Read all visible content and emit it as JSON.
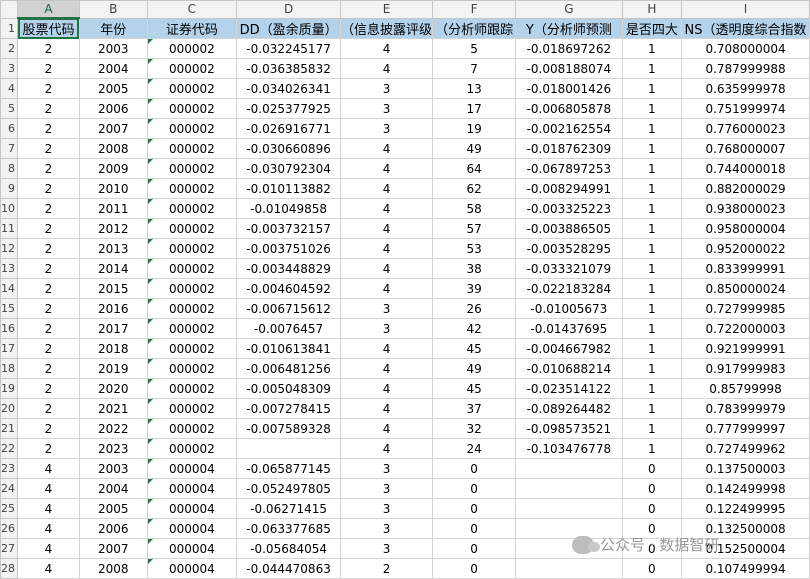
{
  "columns": [
    "A",
    "B",
    "C",
    "D",
    "E",
    "F",
    "G",
    "H",
    "I"
  ],
  "fields": [
    "股票代码",
    "年份",
    "证券代码",
    "DD（盈余质量）",
    "（信息披露评级",
    "（分析师跟踪",
    "Y（分析师预测",
    "是否四大",
    "NS（透明度综合指数"
  ],
  "row_numbers": [
    "1",
    "2",
    "3",
    "4",
    "5",
    "6",
    "7",
    "8",
    "9",
    "10",
    "11",
    "12",
    "13",
    "14",
    "15",
    "16",
    "17",
    "18",
    "19",
    "20",
    "21",
    "22",
    "23",
    "24",
    "25",
    "26",
    "27",
    "28"
  ],
  "rows": [
    [
      "2",
      "2003",
      "000002",
      "-0.032245177",
      "4",
      "5",
      "-0.018697262",
      "1",
      "0.708000004"
    ],
    [
      "2",
      "2004",
      "000002",
      "-0.036385832",
      "4",
      "7",
      "-0.008188074",
      "1",
      "0.787999988"
    ],
    [
      "2",
      "2005",
      "000002",
      "-0.034026341",
      "3",
      "13",
      "-0.018001426",
      "1",
      "0.635999978"
    ],
    [
      "2",
      "2006",
      "000002",
      "-0.025377925",
      "3",
      "17",
      "-0.006805878",
      "1",
      "0.751999974"
    ],
    [
      "2",
      "2007",
      "000002",
      "-0.026916771",
      "3",
      "19",
      "-0.002162554",
      "1",
      "0.776000023"
    ],
    [
      "2",
      "2008",
      "000002",
      "-0.030660896",
      "4",
      "49",
      "-0.018762309",
      "1",
      "0.768000007"
    ],
    [
      "2",
      "2009",
      "000002",
      "-0.030792304",
      "4",
      "64",
      "-0.067897253",
      "1",
      "0.744000018"
    ],
    [
      "2",
      "2010",
      "000002",
      "-0.010113882",
      "4",
      "62",
      "-0.008294991",
      "1",
      "0.882000029"
    ],
    [
      "2",
      "2011",
      "000002",
      "-0.01049858",
      "4",
      "58",
      "-0.003325223",
      "1",
      "0.938000023"
    ],
    [
      "2",
      "2012",
      "000002",
      "-0.003732157",
      "4",
      "57",
      "-0.003886505",
      "1",
      "0.958000004"
    ],
    [
      "2",
      "2013",
      "000002",
      "-0.003751026",
      "4",
      "53",
      "-0.003528295",
      "1",
      "0.952000022"
    ],
    [
      "2",
      "2014",
      "000002",
      "-0.003448829",
      "4",
      "38",
      "-0.033321079",
      "1",
      "0.833999991"
    ],
    [
      "2",
      "2015",
      "000002",
      "-0.004604592",
      "4",
      "39",
      "-0.022183284",
      "1",
      "0.850000024"
    ],
    [
      "2",
      "2016",
      "000002",
      "-0.006715612",
      "3",
      "26",
      "-0.01005673",
      "1",
      "0.727999985"
    ],
    [
      "2",
      "2017",
      "000002",
      "-0.0076457",
      "3",
      "42",
      "-0.01437695",
      "1",
      "0.722000003"
    ],
    [
      "2",
      "2018",
      "000002",
      "-0.010613841",
      "4",
      "45",
      "-0.004667982",
      "1",
      "0.921999991"
    ],
    [
      "2",
      "2019",
      "000002",
      "-0.006481256",
      "4",
      "49",
      "-0.010688214",
      "1",
      "0.917999983"
    ],
    [
      "2",
      "2020",
      "000002",
      "-0.005048309",
      "4",
      "45",
      "-0.023514122",
      "1",
      "0.85799998"
    ],
    [
      "2",
      "2021",
      "000002",
      "-0.007278415",
      "4",
      "37",
      "-0.089264482",
      "1",
      "0.783999979"
    ],
    [
      "2",
      "2022",
      "000002",
      "-0.007589328",
      "4",
      "32",
      "-0.098573521",
      "1",
      "0.777999997"
    ],
    [
      "2",
      "2023",
      "000002",
      "",
      "4",
      "24",
      "-0.103476778",
      "1",
      "0.727499962"
    ],
    [
      "4",
      "2003",
      "000004",
      "-0.065877145",
      "3",
      "0",
      "",
      "0",
      "0.137500003"
    ],
    [
      "4",
      "2004",
      "000004",
      "-0.052497805",
      "3",
      "0",
      "",
      "0",
      "0.142499998"
    ],
    [
      "4",
      "2005",
      "000004",
      "-0.06271415",
      "3",
      "0",
      "",
      "0",
      "0.122499995"
    ],
    [
      "4",
      "2006",
      "000004",
      "-0.063377685",
      "3",
      "0",
      "",
      "0",
      "0.132500008"
    ],
    [
      "4",
      "2007",
      "000004",
      "-0.05684054",
      "3",
      "0",
      "",
      "0",
      "0.152500004"
    ],
    [
      "4",
      "2008",
      "000004",
      "-0.044470863",
      "2",
      "0",
      "",
      "0",
      "0.107499994"
    ]
  ],
  "watermark": "公众号 · 数据智研"
}
